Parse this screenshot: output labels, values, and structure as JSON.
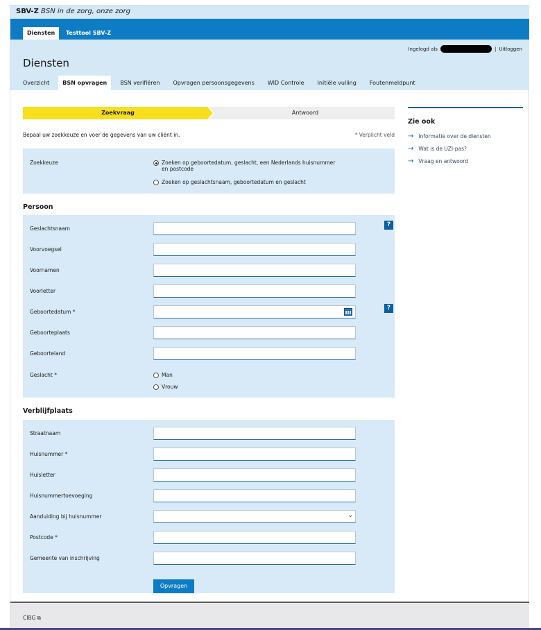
{
  "topbar": {
    "brand": "SBV-Z",
    "tagline": "BSN in de zorg, onze zorg"
  },
  "topnav": {
    "active_tab": "Diensten",
    "link_tab": "Testtool SBV-Z"
  },
  "header": {
    "logged_in_label": "Ingelogd als",
    "separator": "|",
    "logout": "Uitloggen",
    "title": "Diensten"
  },
  "subnav": [
    "Overzicht",
    "BSN opvragen",
    "BSN verifiëren",
    "Opvragen persoonsgegevens",
    "WID Controle",
    "Initiële vulling",
    "Foutenmeldpunt"
  ],
  "steps": {
    "step1": "Zoekvraag",
    "step2": "Antwoord"
  },
  "intro": "Bepaal uw zoekkeuze en voer de gegevens van uw cliënt in.",
  "required_note": "* Verplicht veld",
  "zoekkeuze": {
    "label": "Zoekkeuze",
    "option1": "Zoeken op geboortedatum, geslacht, een Nederlands huisnummer",
    "option1_cont": "en postcode",
    "option2": "Zoeken op geslachtsnaam, geboortedatum en geslacht"
  },
  "persoon": {
    "title": "Persoon",
    "fields": [
      "Geslachtsnaam",
      "Voorvoegsel",
      "Voornamen",
      "Voorletter",
      "Geboortedatum *",
      "Geboorteplaats",
      "Geboorteland"
    ],
    "geslacht_label": "Geslacht *",
    "geslacht_options": [
      "Man",
      "Vrouw"
    ]
  },
  "verblijfplaats": {
    "title": "Verblijfplaats",
    "fields": [
      "Straatnaam",
      "Huisnummer *",
      "Huisletter",
      "Huisnummertoevoeging",
      "Aanduiding bij huisnummer",
      "Postcode *",
      "Gemeente van inschrijving"
    ]
  },
  "submit_label": "Opvragen",
  "help_glyph": "?",
  "sidebar": {
    "title": "Zie ook",
    "links": [
      "Informatie over de diensten",
      "Wat is de UZI-pas?",
      "Vraag en antwoord"
    ]
  },
  "footer": {
    "text": "CIBG ⧉"
  },
  "colors": {
    "brand_blue": "#0e7cc4",
    "panel_blue": "#d8eaf7",
    "step_yellow": "#f7df1e"
  }
}
